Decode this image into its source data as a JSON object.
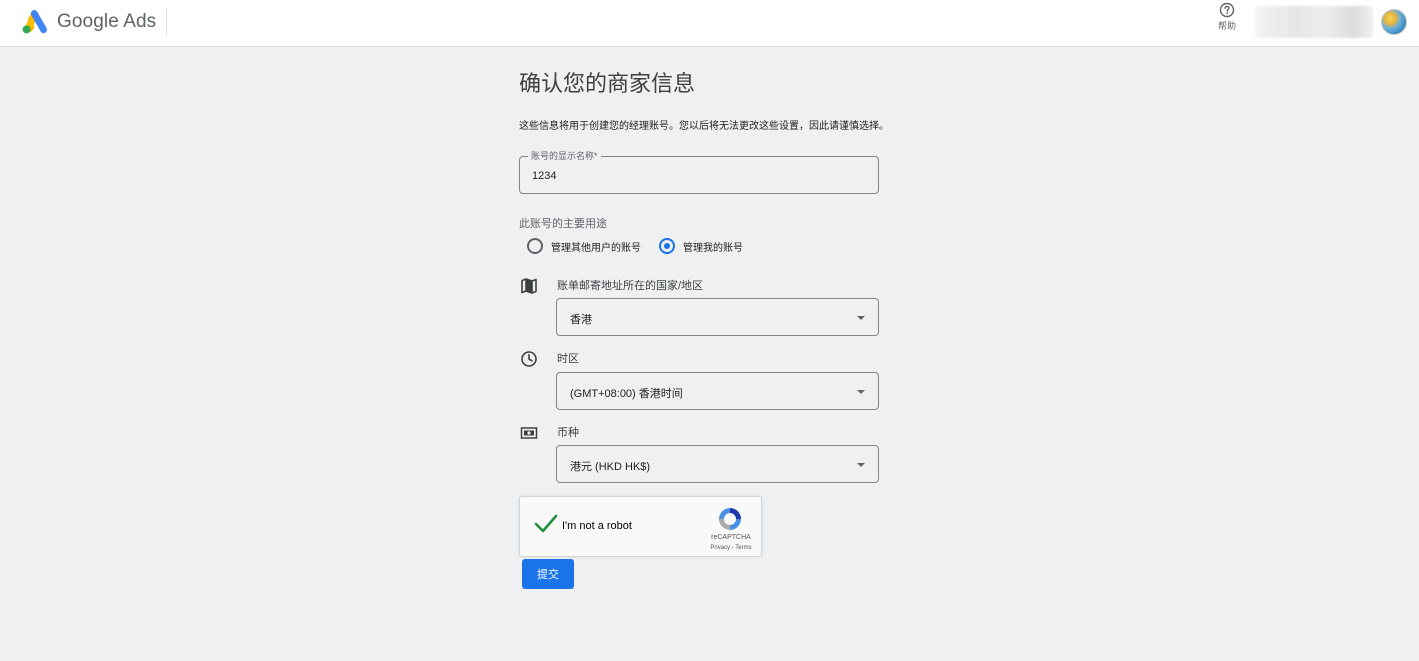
{
  "header": {
    "brand": "Google Ads",
    "help_label": "帮助",
    "logo_icon": "google-ads-logo",
    "help_icon": "help-circle-icon"
  },
  "main": {
    "title": "确认您的商家信息",
    "description": "这些信息将用于创建您的经理账号。您以后将无法更改这些设置，因此请谨慎选择。",
    "account_name": {
      "label": "账号的显示名称*",
      "value": "1234"
    },
    "purpose": {
      "label": "此账号的主要用途",
      "options": [
        {
          "label": "管理其他用户的账号",
          "selected": false
        },
        {
          "label": "管理我的账号",
          "selected": true
        }
      ]
    },
    "country": {
      "label": "账单邮寄地址所在的国家/地区",
      "value": "香港",
      "icon": "map-icon"
    },
    "timezone": {
      "label": "时区",
      "value": "(GMT+08:00) 香港时间",
      "icon": "clock-icon"
    },
    "currency": {
      "label": "币种",
      "value": "港元 (HKD HK$)",
      "icon": "currency-icon"
    },
    "captcha": {
      "text": "I'm not a robot",
      "brand": "reCAPTCHA",
      "links": "Privacy - Terms",
      "checked": true
    },
    "submit_label": "提交"
  },
  "colors": {
    "accent": "#1a73e8",
    "background": "#eff0f2",
    "check_green": "#1e8e3e"
  }
}
